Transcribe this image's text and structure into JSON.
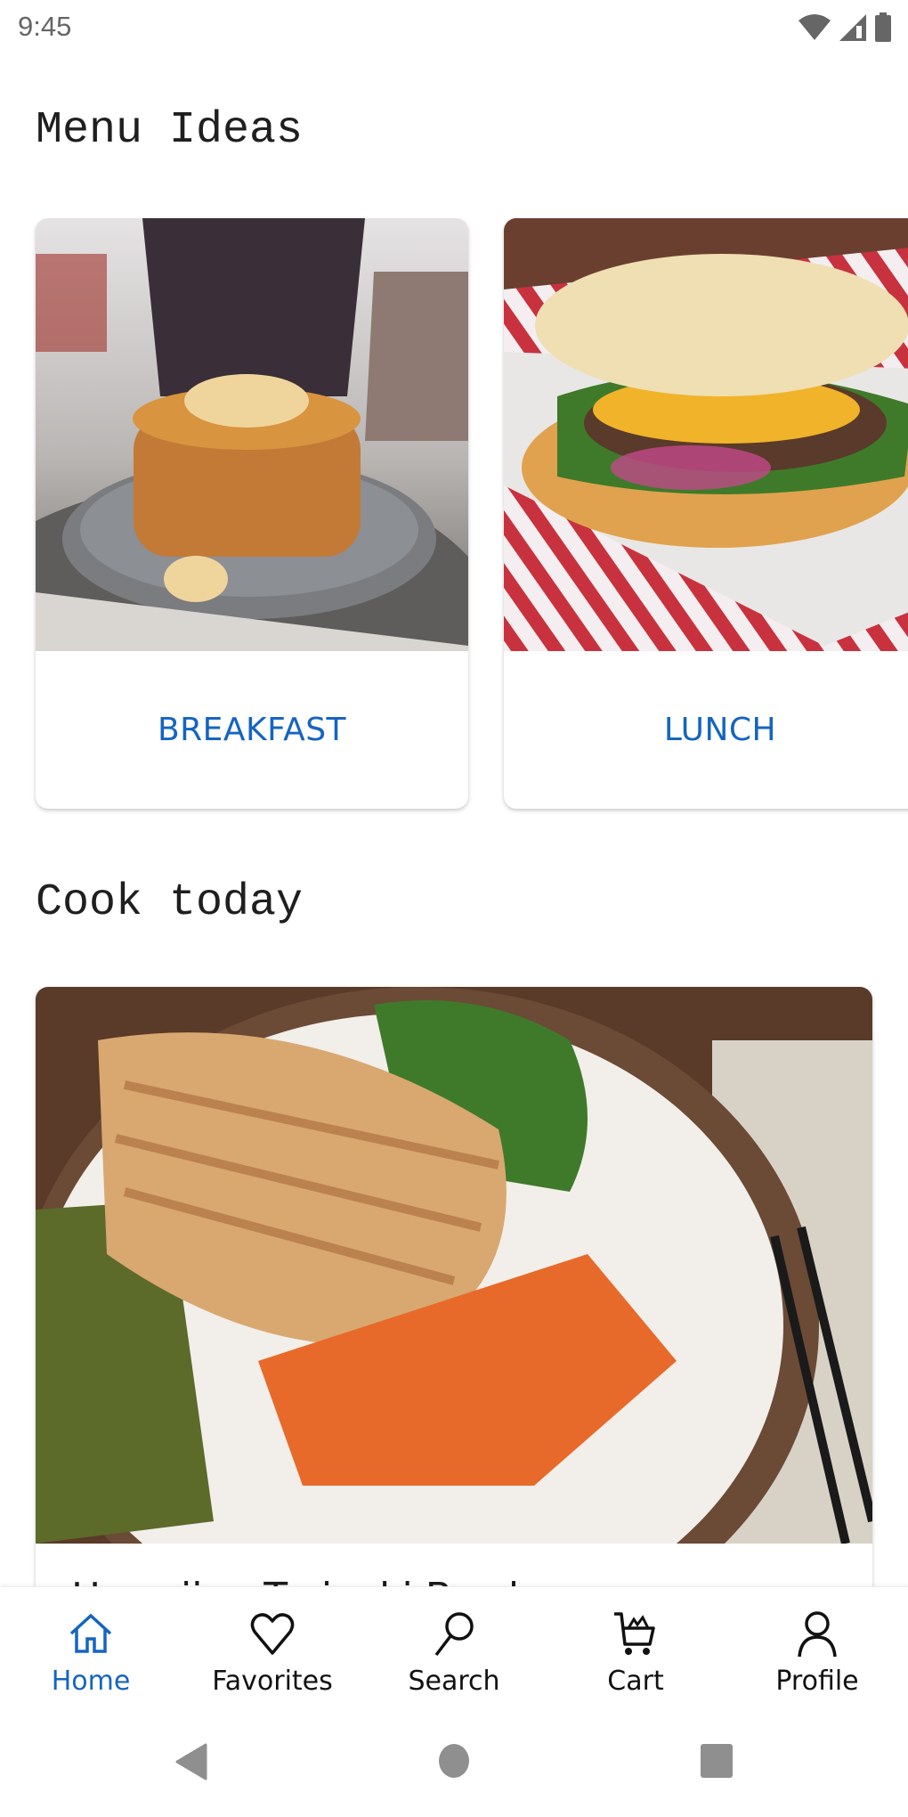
{
  "status_bar": {
    "time": "9:45",
    "icons": [
      "wifi-icon",
      "cellular-signal-icon",
      "battery-icon"
    ]
  },
  "sections": {
    "menu_ideas": {
      "title": "Menu Ideas",
      "cards": [
        {
          "label": "BREAKFAST",
          "image": "pancakes-photo"
        },
        {
          "label": "LUNCH",
          "image": "burger-photo"
        }
      ]
    },
    "cook_today": {
      "title": "Cook today",
      "card": {
        "title": "Hawaiian Teriyaki Bowl",
        "image": "teriyaki-chicken-bowl-photo"
      }
    }
  },
  "bottom_nav": {
    "active": "Home",
    "items": [
      {
        "label": "Home",
        "icon": "home-icon"
      },
      {
        "label": "Favorites",
        "icon": "heart-icon"
      },
      {
        "label": "Search",
        "icon": "search-icon"
      },
      {
        "label": "Cart",
        "icon": "cart-icon"
      },
      {
        "label": "Profile",
        "icon": "profile-icon"
      }
    ]
  },
  "system_nav": [
    "back-button",
    "home-button",
    "recents-button"
  ],
  "colors": {
    "accent": "#1565C0",
    "text": "#1A1A1A",
    "status_gray": "#666666"
  }
}
